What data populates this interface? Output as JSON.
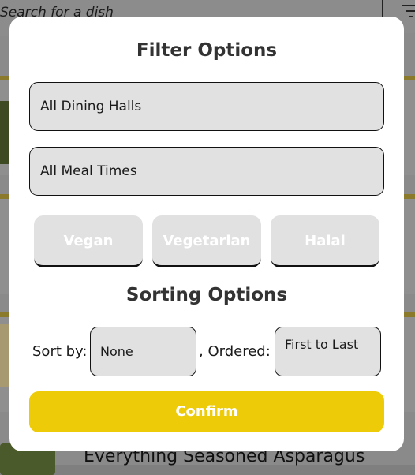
{
  "background": {
    "search_placeholder": "Search for a dish",
    "bottom_item_title": "Everything Seasoned Asparagus"
  },
  "modal": {
    "title": "Filter Options",
    "dining_hall_select": "All Dining Halls",
    "meal_time_select": "All Meal Times",
    "diet_buttons": [
      "Vegan",
      "Vegetarian",
      "Halal"
    ],
    "sorting_title": "Sorting Options",
    "sort_by_label": "Sort by:",
    "sort_by_value": "None",
    "ordered_label": ", Ordered:",
    "ordered_value": "First to Last",
    "confirm_label": "Confirm"
  },
  "colors": {
    "accent": "#eecb08",
    "button_bg": "#e1e1e1",
    "title_text": "#333333"
  }
}
